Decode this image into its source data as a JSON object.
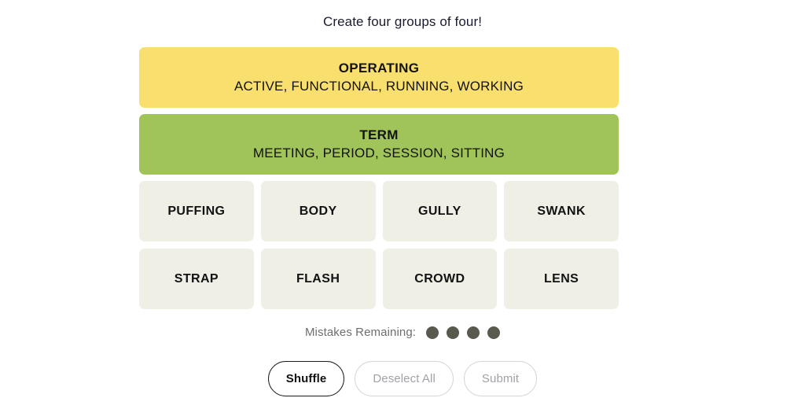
{
  "page": {
    "title": "Create four groups of four!"
  },
  "board": {
    "solved_groups": [
      {
        "title": "OPERATING",
        "members": "ACTIVE, FUNCTIONAL, RUNNING, WORKING",
        "color": "#f9df6d",
        "difficulty": "yellow"
      },
      {
        "title": "TERM",
        "members": "MEETING, PERIOD, SESSION, SITTING",
        "color": "#a0c35a",
        "difficulty": "green"
      }
    ],
    "tiles": [
      {
        "word": "PUFFING",
        "selected": false
      },
      {
        "word": "BODY",
        "selected": false
      },
      {
        "word": "GULLY",
        "selected": false
      },
      {
        "word": "SWANK",
        "selected": false
      },
      {
        "word": "STRAP",
        "selected": false
      },
      {
        "word": "FLASH",
        "selected": false
      },
      {
        "word": "CROWD",
        "selected": false
      },
      {
        "word": "LENS",
        "selected": false
      }
    ],
    "tile_background": "#efefe6"
  },
  "mistakes": {
    "label": "Mistakes Remaining:",
    "remaining": 4,
    "dot_color": "#5a594e",
    "label_color": "#6e6e6e"
  },
  "controls": {
    "shuffle": {
      "label": "Shuffle",
      "enabled": true
    },
    "deselect_all": {
      "label": "Deselect All",
      "enabled": false
    },
    "submit": {
      "label": "Submit",
      "enabled": false
    }
  }
}
